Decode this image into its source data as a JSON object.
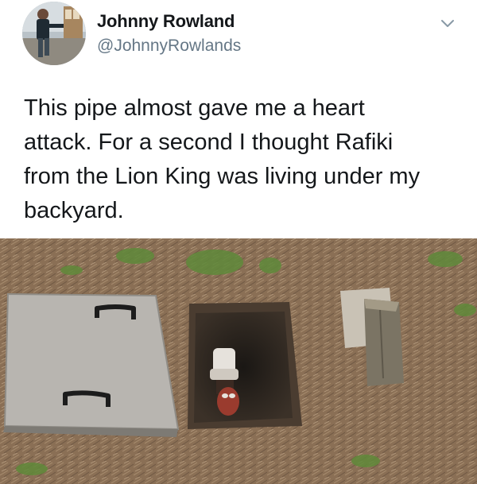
{
  "author": {
    "display_name": "Johnny Rowland",
    "handle": "@JohnnyRowlands"
  },
  "menu_icon": "chevron-down-icon",
  "tweet": {
    "lines": [
      "This pipe almost gave me a heart",
      "attack. For a second I thought Rafiki",
      "from the Lion King was living under my",
      "backyard."
    ]
  },
  "colors": {
    "name": "#14171a",
    "handle": "#657786",
    "grass": "#5f8a3a",
    "soil": "#8a6f55"
  }
}
